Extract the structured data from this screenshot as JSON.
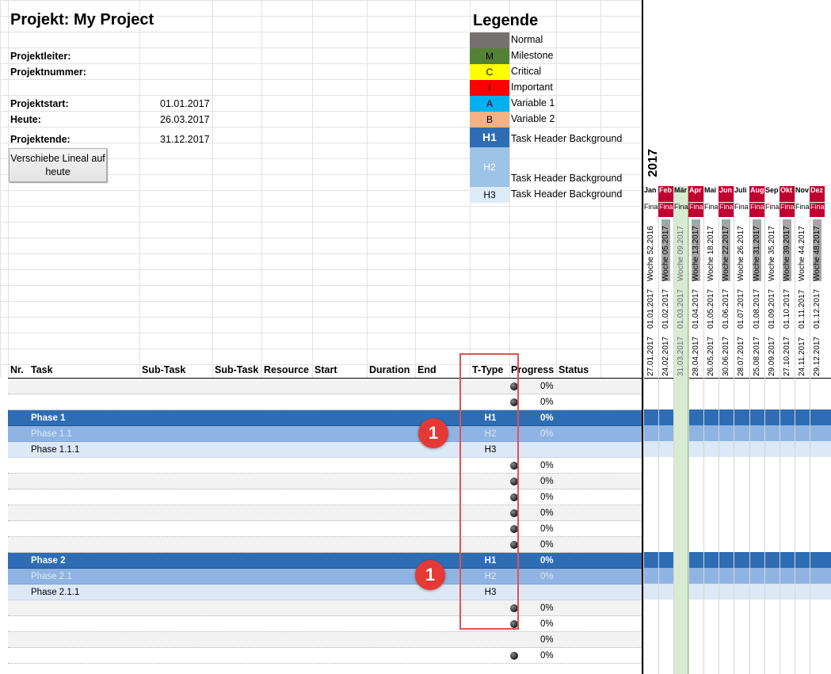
{
  "project": {
    "title": "Projekt: My Project",
    "labels": {
      "leiter": "Projektleiter:",
      "nummer": "Projektnummer:",
      "start": "Projektstart:",
      "heute": "Heute:",
      "ende": "Projektende:"
    },
    "values": {
      "start": "01.01.2017",
      "heute": "26.03.2017",
      "ende": "31.12.2017"
    },
    "button_label": "Verschiebe Lineal auf heute"
  },
  "legend": {
    "title": "Legende",
    "items": [
      {
        "code": "",
        "label": "Normal",
        "color": "#757171"
      },
      {
        "code": "M",
        "label": "Milestone",
        "color": "#548235"
      },
      {
        "code": "C",
        "label": "Critical",
        "color": "#ffff00"
      },
      {
        "code": "I",
        "label": "Important",
        "color": "#ff0000"
      },
      {
        "code": "A",
        "label": "Variable 1",
        "color": "#00b0f0"
      },
      {
        "code": "B",
        "label": "Variable 2",
        "color": "#f4b183"
      },
      {
        "code": "H1",
        "label": "Task Header Background",
        "color": "#2e6db4"
      },
      {
        "code": "H2",
        "label": "Task Header Background",
        "color": "#9dc3e6"
      },
      {
        "code": "H3",
        "label": "Task Header Background",
        "color": "#ddebf7"
      }
    ]
  },
  "table": {
    "headers": {
      "nr": "Nr.",
      "task": "Task",
      "subtask1": "Sub-Task",
      "subtask2": "Sub-Task",
      "resource": "Resource",
      "start": "Start",
      "duration": "Duration",
      "end": "End",
      "ttype": "T-Type",
      "progress": "Progress",
      "status": "Status"
    },
    "rows": [
      {
        "task": "",
        "type": "",
        "progress": "0%",
        "dot": true,
        "style": "alt"
      },
      {
        "task": "",
        "type": "",
        "progress": "0%",
        "dot": true,
        "style": ""
      },
      {
        "task": "Phase 1",
        "type": "H1",
        "progress": "0%",
        "dot": false,
        "style": "h1"
      },
      {
        "task": "Phase 1.1",
        "type": "H2",
        "progress": "0%",
        "dot": false,
        "style": "h2"
      },
      {
        "task": "Phase 1.1.1",
        "type": "H3",
        "progress": "",
        "dot": false,
        "style": "h3"
      },
      {
        "task": "",
        "type": "",
        "progress": "0%",
        "dot": true,
        "style": ""
      },
      {
        "task": "",
        "type": "",
        "progress": "0%",
        "dot": true,
        "style": "alt"
      },
      {
        "task": "",
        "type": "",
        "progress": "0%",
        "dot": true,
        "style": ""
      },
      {
        "task": "",
        "type": "",
        "progress": "0%",
        "dot": true,
        "style": "alt"
      },
      {
        "task": "",
        "type": "",
        "progress": "0%",
        "dot": true,
        "style": ""
      },
      {
        "task": "",
        "type": "",
        "progress": "0%",
        "dot": true,
        "style": "alt"
      },
      {
        "task": "Phase 2",
        "type": "H1",
        "progress": "0%",
        "dot": false,
        "style": "h1"
      },
      {
        "task": "Phase 2.1",
        "type": "H2",
        "progress": "0%",
        "dot": false,
        "style": "h2"
      },
      {
        "task": "Phase 2.1.1",
        "type": "H3",
        "progress": "",
        "dot": false,
        "style": "h3"
      },
      {
        "task": "",
        "type": "",
        "progress": "0%",
        "dot": true,
        "style": "alt"
      },
      {
        "task": "",
        "type": "",
        "progress": "0%",
        "dot": true,
        "style": ""
      },
      {
        "task": "",
        "type": "",
        "progress": "0%",
        "dot": false,
        "style": "alt"
      },
      {
        "task": "",
        "type": "",
        "progress": "0%",
        "dot": true,
        "style": ""
      }
    ]
  },
  "gantt": {
    "year": "2017",
    "columns": [
      {
        "month": "Jan",
        "fin": "Fina",
        "week": "Woche 52.2016",
        "start": "01.01.2017",
        "end": "27.01.2017",
        "red": false,
        "today": false
      },
      {
        "month": "Feb",
        "fin": "Fina",
        "week": "Woche 05.2017",
        "start": "01.02.2017",
        "end": "24.02.2017",
        "red": true,
        "today": false
      },
      {
        "month": "Mär",
        "fin": "Fina",
        "week": "Woche 09.2017",
        "start": "01.03.2017",
        "end": "31.03.2017",
        "red": false,
        "today": true
      },
      {
        "month": "Apr",
        "fin": "Fina",
        "week": "Woche 13.2017",
        "start": "01.04.2017",
        "end": "28.04.2017",
        "red": true,
        "today": false
      },
      {
        "month": "Mai",
        "fin": "Fina",
        "week": "Woche 18.2017",
        "start": "01.05.2017",
        "end": "26.05.2017",
        "red": false,
        "today": false
      },
      {
        "month": "Jun",
        "fin": "Fina",
        "week": "Woche 22.2017",
        "start": "01.06.2017",
        "end": "30.06.2017",
        "red": true,
        "today": false
      },
      {
        "month": "Juli",
        "fin": "Fina",
        "week": "Woche 26.2017",
        "start": "01.07.2017",
        "end": "28.07.2017",
        "red": false,
        "today": false
      },
      {
        "month": "Aug",
        "fin": "Fina",
        "week": "Woche 31.2017",
        "start": "01.08.2017",
        "end": "25.08.2017",
        "red": true,
        "today": false
      },
      {
        "month": "Sep",
        "fin": "Fina",
        "week": "Woche 35.2017",
        "start": "01.09.2017",
        "end": "29.09.2017",
        "red": false,
        "today": false
      },
      {
        "month": "Okt",
        "fin": "Fina",
        "week": "Woche 39.2017",
        "start": "01.10.2017",
        "end": "27.10.2017",
        "red": true,
        "today": false
      },
      {
        "month": "Nov",
        "fin": "Fina",
        "week": "Woche 44.2017",
        "start": "01.11.2017",
        "end": "24.11.2017",
        "red": false,
        "today": false
      },
      {
        "month": "Dez",
        "fin": "Fina",
        "week": "Woche 48.2017",
        "start": "01.12.2017",
        "end": "29.12.2017",
        "red": true,
        "today": false
      }
    ]
  },
  "annotations": {
    "badge_label": "1"
  },
  "colors": {
    "h1": "#2e6db4",
    "h2": "#8fb4e3",
    "h3": "#dce8f6",
    "month_red": "#c00030",
    "today": "#d9ead3",
    "highlight": "#e05252"
  }
}
